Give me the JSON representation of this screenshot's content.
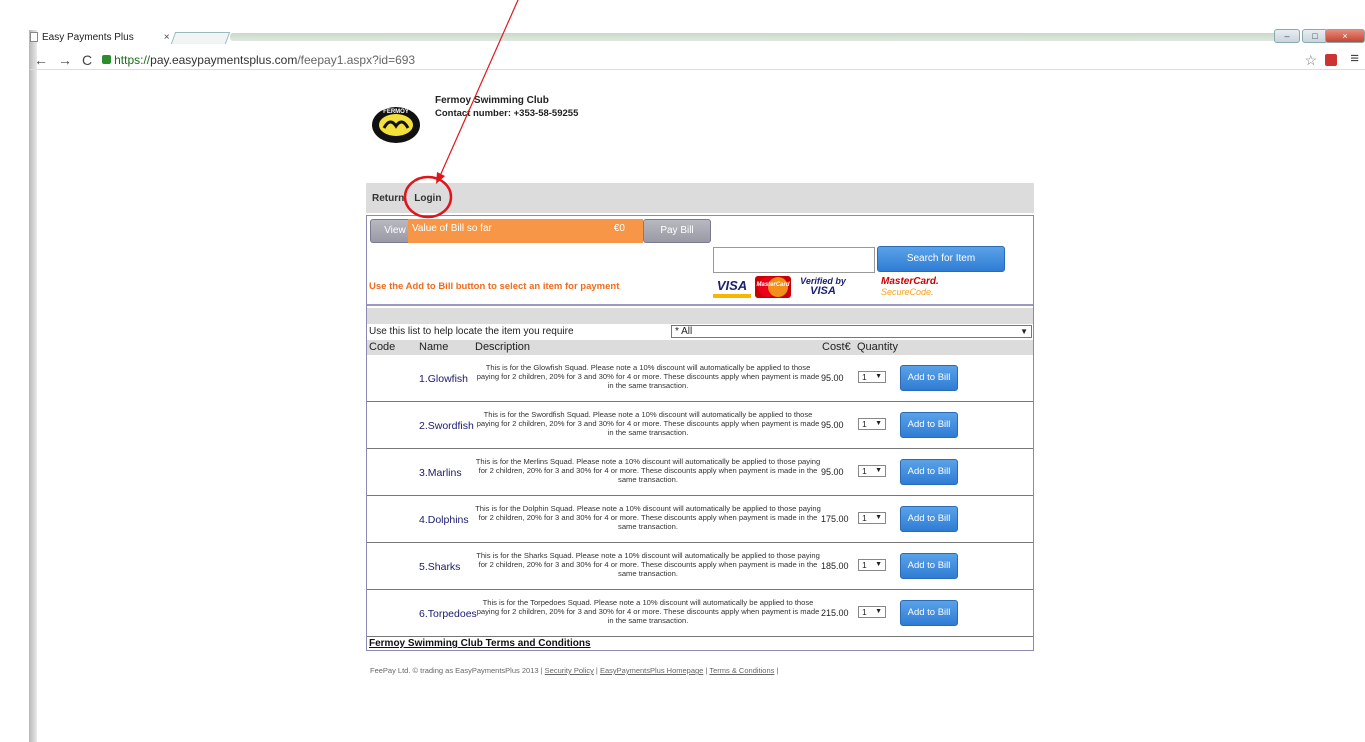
{
  "browser": {
    "tab_title": "Easy Payments Plus",
    "tab_close": "×",
    "nav_back": "←",
    "nav_forward": "→",
    "nav_reload": "C",
    "url_scheme": "https://",
    "url_host": "pay.easypaymentsplus.com",
    "url_path": "/feepay1.aspx?id=693",
    "star": "☆",
    "menu": "≡"
  },
  "club": {
    "name": "Fermoy Swimming Club",
    "contact": "Contact number: +353-58-59255",
    "logo_text": "FERMOY"
  },
  "nav": {
    "return_label": "Return",
    "login_label": "Login"
  },
  "bill": {
    "view_label": "View Bill",
    "value_label": "Value of Bill so far",
    "value_amount": "€0",
    "pay_label": "Pay Bill"
  },
  "search": {
    "button_label": "Search for Item",
    "value": ""
  },
  "instruction": "Use the Add to Bill button to select an item for payment",
  "payment_logos": {
    "visa": "VISA",
    "mastercard": "MasterCard",
    "verified_by": "Verified by",
    "verified_visa": "VISA",
    "mc_securecode_1": "MasterCard.",
    "mc_securecode_2": "SecureCode."
  },
  "filter": {
    "label": "Use this list to help locate the item you require",
    "selected": "* All"
  },
  "table": {
    "headers": {
      "code": "Code",
      "name": "Name",
      "description": "Description",
      "cost": "Cost€",
      "quantity": "Quantity"
    },
    "add_label": "Add to Bill",
    "rows": [
      {
        "name": "1.Glowfish",
        "description": "This is for the Glowfish Squad. Please note a 10% discount will automatically be applied to those paying for 2 children, 20% for 3 and 30% for 4 or more. These discounts apply when payment is made in the same transaction.",
        "cost": "95.00",
        "qty": "1"
      },
      {
        "name": "2.Swordfish",
        "description": "This is for the Swordfish Squad. Please note a 10% discount will automatically be applied to those paying for 2 children, 20% for 3 and 30% for 4 or more. These discounts apply when payment is made in the same transaction.",
        "cost": "95.00",
        "qty": "1"
      },
      {
        "name": "3.Marlins",
        "description": "This is for the Merlins Squad. Please note a 10% discount will automatically be applied to those paying for 2 children, 20% for 3 and 30% for 4 or more. These discounts apply when payment is made in the same transaction.",
        "cost": "95.00",
        "qty": "1"
      },
      {
        "name": "4.Dolphins",
        "description": "This is for the Dolphin Squad. Please note a 10% discount will automatically be applied to those paying for 2 children, 20% for 3 and 30% for 4 or more. These discounts apply when payment is made in the same transaction.",
        "cost": "175.00",
        "qty": "1"
      },
      {
        "name": "5.Sharks",
        "description": "This is for the Sharks Squad. Please note a 10% discount will automatically be applied to those paying for 2 children, 20% for 3 and 30% for 4 or more. These discounts apply when payment is made in the same transaction.",
        "cost": "185.00",
        "qty": "1"
      },
      {
        "name": "6.Torpedoes",
        "description": "This is for the Torpedoes Squad. Please note a 10% discount will automatically be applied to those paying for 2 children, 20% for 3 and 30% for 4 or more. These discounts apply when payment is made in the same transaction.",
        "cost": "215.00",
        "qty": "1"
      }
    ]
  },
  "terms_link": "Fermoy Swimming Club Terms and Conditions",
  "footer": {
    "prefix": "FeePay Ltd. © trading as EasyPaymentsPlus 2013 | ",
    "security": "Security Policy",
    "homepage": "EasyPaymentsPlus Homepage",
    "terms": "Terms & Conditions",
    "sep": " | "
  },
  "colors": {
    "annotation": "#e0151b",
    "bill_orange": "#f79646",
    "instruction_orange": "#f26b1d",
    "button_blue": "#2f7cd4"
  }
}
